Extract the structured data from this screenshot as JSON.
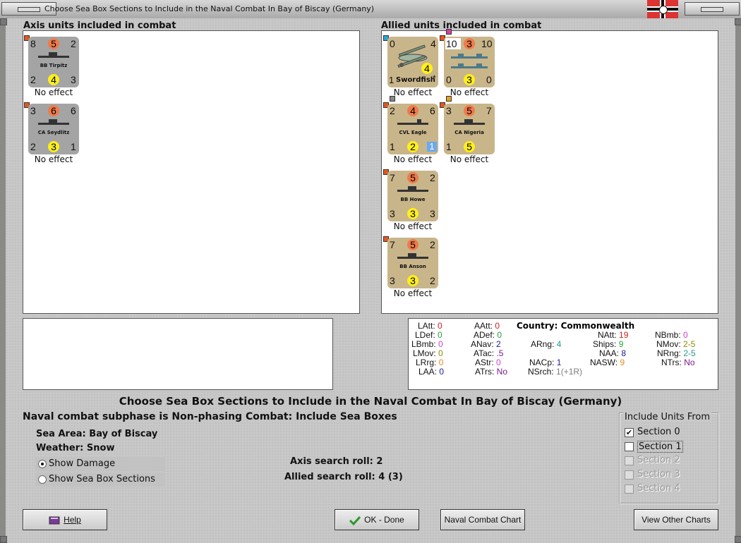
{
  "window": {
    "title": "Choose Sea Box Sections to Include in the Naval Combat In Bay of Biscay (Germany)"
  },
  "axis_panel": {
    "header": "Axis units included in combat",
    "units": [
      {
        "name": "BB Tirpitz",
        "tl": "8",
        "tc": "5",
        "tr": "2",
        "bl": "2",
        "bc": "4",
        "br": "3",
        "effect": "No effect"
      },
      {
        "name": "CA Seydlitz",
        "tl": "3",
        "tc": "6",
        "tr": "6",
        "bl": "2",
        "bc": "3",
        "br": "1",
        "effect": "No effect"
      }
    ]
  },
  "allied_panel": {
    "header": "Allied units included in combat",
    "units": [
      {
        "name": "Swordfish",
        "tl": "0",
        "tr": "4",
        "bl": "1",
        "bc": "4",
        "br": "*",
        "effect": "No effect"
      },
      {
        "name": "",
        "tl": "10",
        "tc": "3",
        "tr": "10",
        "bl": "0",
        "bc": "3",
        "br": "0",
        "effect": "No effect"
      },
      {
        "name": "CVL Eagle",
        "tl": "2",
        "tc": "4",
        "tr": "6",
        "bl": "1",
        "bc": "2",
        "br": "1",
        "effect": "No effect"
      },
      {
        "name": "CA Nigeria",
        "tl": "3",
        "tc": "5",
        "tr": "7",
        "bl": "1",
        "bc": "5",
        "br": "",
        "effect": "No effect"
      },
      {
        "name": "BB Howe",
        "tl": "7",
        "tc": "5",
        "tr": "2",
        "bl": "3",
        "bc": "3",
        "br": "3",
        "effect": "No effect"
      },
      {
        "name": "BB Anson",
        "tl": "7",
        "tc": "5",
        "tr": "2",
        "bl": "3",
        "bc": "3",
        "br": "2",
        "effect": "No effect"
      }
    ]
  },
  "stats": {
    "country_label": "Country:",
    "country_value": "Commonwealth",
    "LAtt": {
      "label": "LAtt:",
      "value": "0"
    },
    "LDef": {
      "label": "LDef:",
      "value": "0"
    },
    "LBmb": {
      "label": "LBmb:",
      "value": "0"
    },
    "LMov": {
      "label": "LMov:",
      "value": "0"
    },
    "LRrg": {
      "label": "LRrg:",
      "value": "0"
    },
    "LAA": {
      "label": "LAA:",
      "value": "0"
    },
    "AAtt": {
      "label": "AAtt:",
      "value": "0"
    },
    "ADef": {
      "label": "ADef:",
      "value": "0"
    },
    "ANav": {
      "label": "ANav:",
      "value": "2"
    },
    "ATac": {
      "label": "ATac:",
      "value": ".5"
    },
    "AStr": {
      "label": "AStr:",
      "value": "0"
    },
    "ATrs": {
      "label": "ATrs:",
      "value": "No"
    },
    "ARng": {
      "label": "ARng:",
      "value": "4"
    },
    "NACp": {
      "label": "NACp:",
      "value": "1"
    },
    "NSrch": {
      "label": "NSrch:",
      "value": "1(+1R)"
    },
    "NAtt": {
      "label": "NAtt:",
      "value": "19"
    },
    "Ships": {
      "label": "Ships:",
      "value": "9"
    },
    "NAA": {
      "label": "NAA:",
      "value": "8"
    },
    "NASW": {
      "label": "NASW:",
      "value": "9"
    },
    "NBmb": {
      "label": "NBmb:",
      "value": "0"
    },
    "NMov": {
      "label": "NMov:",
      "value": "2-5"
    },
    "NRng": {
      "label": "NRng:",
      "value": "2-5"
    },
    "NTrs": {
      "label": "NTrs:",
      "value": "No"
    }
  },
  "dialog": {
    "title": "Choose Sea Box Sections to Include in the Naval Combat In Bay of Biscay (Germany)",
    "subphase": "Naval combat subphase is Non-phasing Combat: Include Sea Boxes",
    "sea_area_label": "Sea Area:",
    "sea_area_value": "Bay of Biscay",
    "weather_label": "Weather:",
    "weather_value": "Snow",
    "axis_search_label": "Axis search roll:",
    "axis_search_value": "2",
    "allied_search_label": "Allied search roll:",
    "allied_search_value": "4 (3)",
    "radio_show_damage": "Show Damage",
    "radio_show_sections": "Show Sea Box Sections"
  },
  "include_units": {
    "title": "Include Units From",
    "sections": [
      {
        "label": "Section 0",
        "checked": true,
        "enabled": true
      },
      {
        "label": "Section 1",
        "checked": false,
        "enabled": true
      },
      {
        "label": "Section 2",
        "checked": false,
        "enabled": false
      },
      {
        "label": "Section 3",
        "checked": false,
        "enabled": false
      },
      {
        "label": "Section 4",
        "checked": false,
        "enabled": false
      }
    ]
  },
  "buttons": {
    "help": "Help",
    "ok": "OK - Done",
    "naval_chart": "Naval Combat Chart",
    "other_charts": "View Other Charts"
  },
  "colors": {
    "counter_axis": "#a4a4a4",
    "counter_allied": "#c9b58a",
    "combat_circle": "#f07a4a",
    "support_circle": "#ffef1a"
  }
}
